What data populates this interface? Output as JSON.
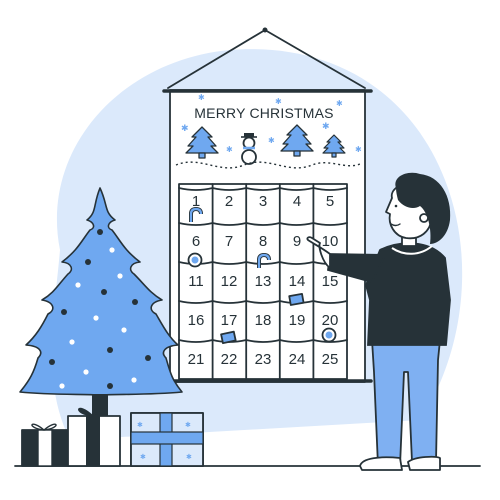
{
  "calendar": {
    "title": "MERRY CHRISTMAS",
    "days": [
      "1",
      "2",
      "3",
      "4",
      "5",
      "6",
      "7",
      "8",
      "9",
      "10",
      "11",
      "12",
      "13",
      "14",
      "15",
      "16",
      "17",
      "18",
      "19",
      "20",
      "21",
      "22",
      "23",
      "24",
      "25"
    ]
  },
  "colors": {
    "accent": "#6fa8f0",
    "accent_light": "#dbe9fb",
    "ink": "#263238",
    "sweater": "#263238",
    "pants": "#7fb0f2"
  }
}
